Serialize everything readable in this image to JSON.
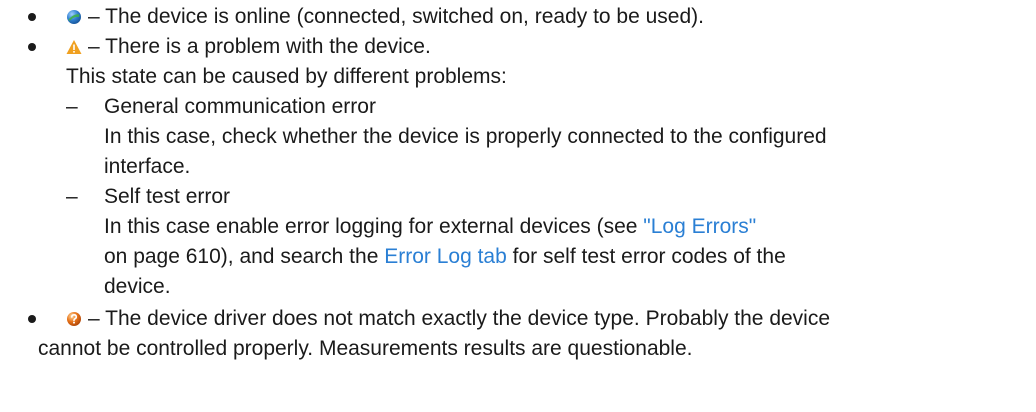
{
  "items": {
    "online": {
      "icon": "online-status-icon",
      "text": "– The device is online (connected, switched on, ready to be used)."
    },
    "problem": {
      "icon": "warning-triangle-icon",
      "text": "– There is a problem with the device.",
      "subtext": "This state can be caused by different problems:",
      "dash": "–",
      "comm_error": {
        "title": "General communication error",
        "line1": "In this case, check whether the device is properly connected to the configured",
        "line2": "interface."
      },
      "self_test": {
        "title": "Self test error",
        "line1_pre": "In this case enable error logging for external devices (see ",
        "line1_link": "\"Log Errors\"",
        "line2_pre": "on page 610), and search the ",
        "line2_link": "Error Log tab",
        "line2_post": " for self test error codes of the",
        "line3": "device."
      }
    },
    "mismatch": {
      "icon": "driver-mismatch-icon",
      "text1": "– The device driver does not match exactly the device type. Probably the device",
      "text2": "cannot be controlled properly. Measurements results are questionable."
    }
  },
  "colors": {
    "text": "#1a1a1a",
    "link": "#2a7fd4",
    "online_blue": "#2f7fd0",
    "warning_orange": "#f0a020",
    "mismatch_orange": "#e8741a"
  }
}
